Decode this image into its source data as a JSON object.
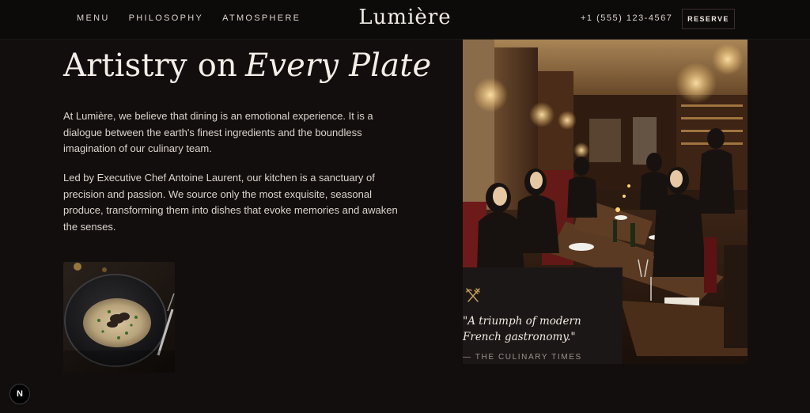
{
  "nav": {
    "links": [
      "MENU",
      "PHILOSOPHY",
      "ATMOSPHERE"
    ],
    "logo": "Lumière",
    "phone": "+1 (555) 123-4567",
    "reserve_label": "RESERVE"
  },
  "section": {
    "headline_plain": "Artistry on",
    "headline_italic": "Every Plate",
    "paragraphs": [
      "At Lumière, we believe that dining is an emotional experience. It is a dialogue between the earth's finest ingredients and the boundless imagination of our culinary team.",
      "Led by Executive Chef Antoine Laurent, our kitchen is a sanctuary of precision and passion. We source only the most exquisite, seasonal produce, transforming them into dishes that evoke memories and awaken the senses."
    ]
  },
  "quote": {
    "icon": "fork-knife-icon",
    "text": "\"A triumph of modern French gastronomy.\"",
    "source": "— THE CULINARY TIMES"
  },
  "images": {
    "dish": "risotto-dish-image",
    "restaurant": "restaurant-interior-image"
  },
  "badge": {
    "label": "N"
  },
  "colors": {
    "background": "#120e0e",
    "nav_background": "#0d0a0a",
    "accent_gold": "#c9a45c",
    "card_background": "#1c1717"
  }
}
